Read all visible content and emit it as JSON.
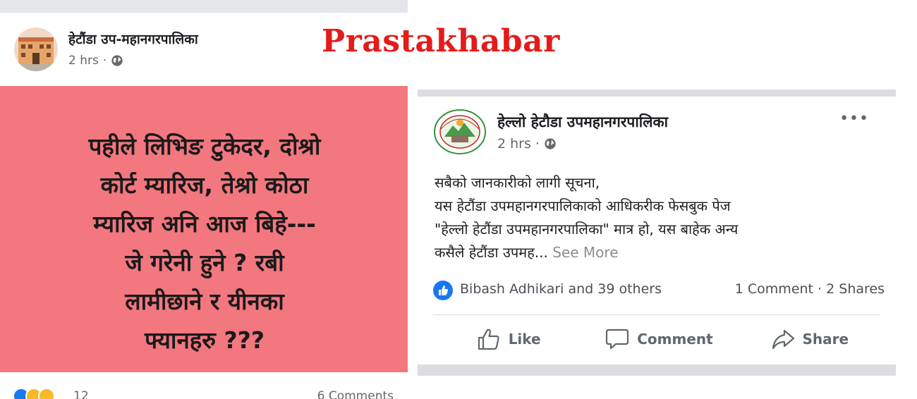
{
  "watermark": "Prastakhabar",
  "left_post": {
    "page_name": "हेटौंडा उप-महानगरपालिका",
    "time": "2 hrs",
    "visibility_icon": "globe-icon",
    "text": "पहीले लिभिङ टुकेदर, दोश्रो\nकोर्ट म्यारिज, तेश्रो कोठा\nम्यारिज अनि आज बिहे---\n    जे गरेनी हुने ? रबी\nलामीछाने र यीनका\nफ्यानहरु ???",
    "panel_color": "#f3777f",
    "reaction_icons": [
      "like-icon",
      "wow-icon",
      "haha-icon"
    ],
    "reaction_count": "12",
    "comments": "6 Comments"
  },
  "right_post": {
    "page_name": "हेल्लो हेटौडा उपमहानगरपालिका",
    "time": "2 hrs",
    "visibility_icon": "globe-icon",
    "body_lines": [
      "सबैको जानकारीको लागी सूचना,",
      "यस हेटौंडा उपमहानगरपालिकाको आधिकरीक फेसबुक पेज",
      "\"हेल्लो हेटौंडा उपमहानगरपालिका\" मात्र हो, यस बाहेक अन्य",
      "कसैले हेटौंडा उपमह..."
    ],
    "see_more": "See More",
    "likers": "Bibash Adhikari and 39 others",
    "comment_count": "1 Comment",
    "share_count": "2 Shares",
    "actions": {
      "like": "Like",
      "comment": "Comment",
      "share": "Share"
    },
    "accent_color": "#1877f2"
  }
}
